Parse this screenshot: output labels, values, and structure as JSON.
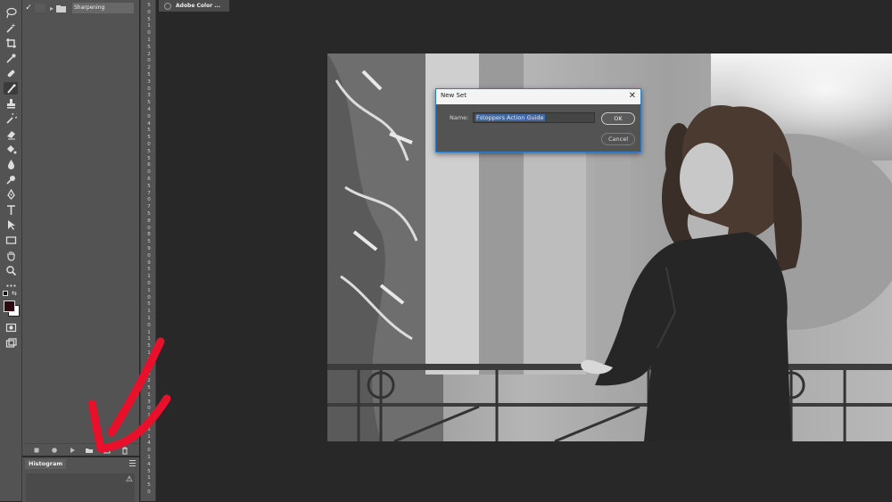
{
  "actions_panel": {
    "set_name": "Sharpening",
    "check_glyph": "✓",
    "bottom_icons": [
      "stop-icon",
      "record-icon",
      "play-icon",
      "new-set-folder-icon",
      "new-action-icon",
      "delete-icon"
    ]
  },
  "histogram": {
    "tab_label": "Histogram",
    "warning_glyph": "⚠"
  },
  "document_tab": {
    "label": "Adobe Color ..."
  },
  "ruler": {
    "labels": [
      "5",
      "0",
      "5",
      "1",
      "0",
      "1",
      "5",
      "2",
      "0",
      "2",
      "5",
      "3",
      "0",
      "3",
      "5",
      "4",
      "0",
      "4",
      "5",
      "5",
      "0",
      "5",
      "5",
      "6",
      "0",
      "6",
      "5",
      "7",
      "0",
      "7",
      "5",
      "8",
      "0",
      "8",
      "5",
      "9",
      "0",
      "9",
      "5",
      "1",
      "0",
      "1",
      "0",
      "5",
      "1",
      "1",
      "0",
      "1",
      "1",
      "5",
      "1",
      "2",
      "0",
      "1",
      "2",
      "5",
      "1",
      "3",
      "0",
      "1",
      "3",
      "5",
      "1",
      "4",
      "0",
      "1",
      "4",
      "5",
      "1",
      "5",
      "0"
    ]
  },
  "dialog": {
    "title": "New Set",
    "close_glyph": "✕",
    "name_label": "Name:",
    "name_value": "Fstoppers Action Guide",
    "ok_label": "OK",
    "cancel_label": "Cancel"
  },
  "toolbar": {
    "tools": [
      "lasso-icon",
      "magic-wand-icon",
      "crop-icon",
      "eyedropper-icon",
      "healing-brush-icon",
      "brush-icon",
      "clone-stamp-icon",
      "history-brush-icon",
      "eraser-icon",
      "paint-bucket-icon",
      "blur-icon",
      "dodge-icon",
      "pen-icon",
      "type-icon",
      "path-selection-icon",
      "rectangle-icon",
      "hand-icon",
      "zoom-icon",
      "more-tools-icon"
    ],
    "selected_tool": "brush-icon",
    "foreground_color": "#2a0a10",
    "background_color": "#ffffff"
  },
  "colors": {
    "accent": "#2b7bd0",
    "annotation": "#e8102a"
  }
}
